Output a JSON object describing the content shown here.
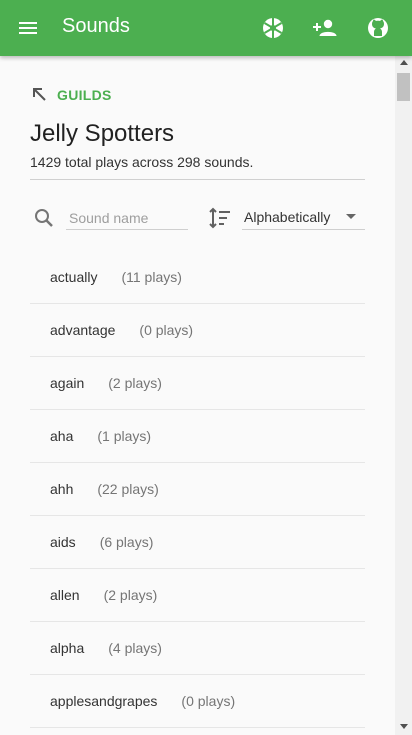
{
  "appbar": {
    "title": "Sounds",
    "color": "#4caf50",
    "icons": [
      "menu-icon",
      "frogger-icon",
      "add-user-icon",
      "github-icon"
    ]
  },
  "back": {
    "label": "GUILDS"
  },
  "guild": {
    "name": "Jelly Spotters",
    "summary": "1429 total plays across 298 sounds."
  },
  "search": {
    "placeholder": "Sound name",
    "value": ""
  },
  "sort": {
    "selected": "Alphabetically"
  },
  "sounds": [
    {
      "name": "actually",
      "plays": "(11 plays)"
    },
    {
      "name": "advantage",
      "plays": "(0 plays)"
    },
    {
      "name": "again",
      "plays": "(2 plays)"
    },
    {
      "name": "aha",
      "plays": "(1 plays)"
    },
    {
      "name": "ahh",
      "plays": "(22 plays)"
    },
    {
      "name": "aids",
      "plays": "(6 plays)"
    },
    {
      "name": "allen",
      "plays": "(2 plays)"
    },
    {
      "name": "alpha",
      "plays": "(4 plays)"
    },
    {
      "name": "applesandgrapes",
      "plays": "(0 plays)"
    }
  ]
}
